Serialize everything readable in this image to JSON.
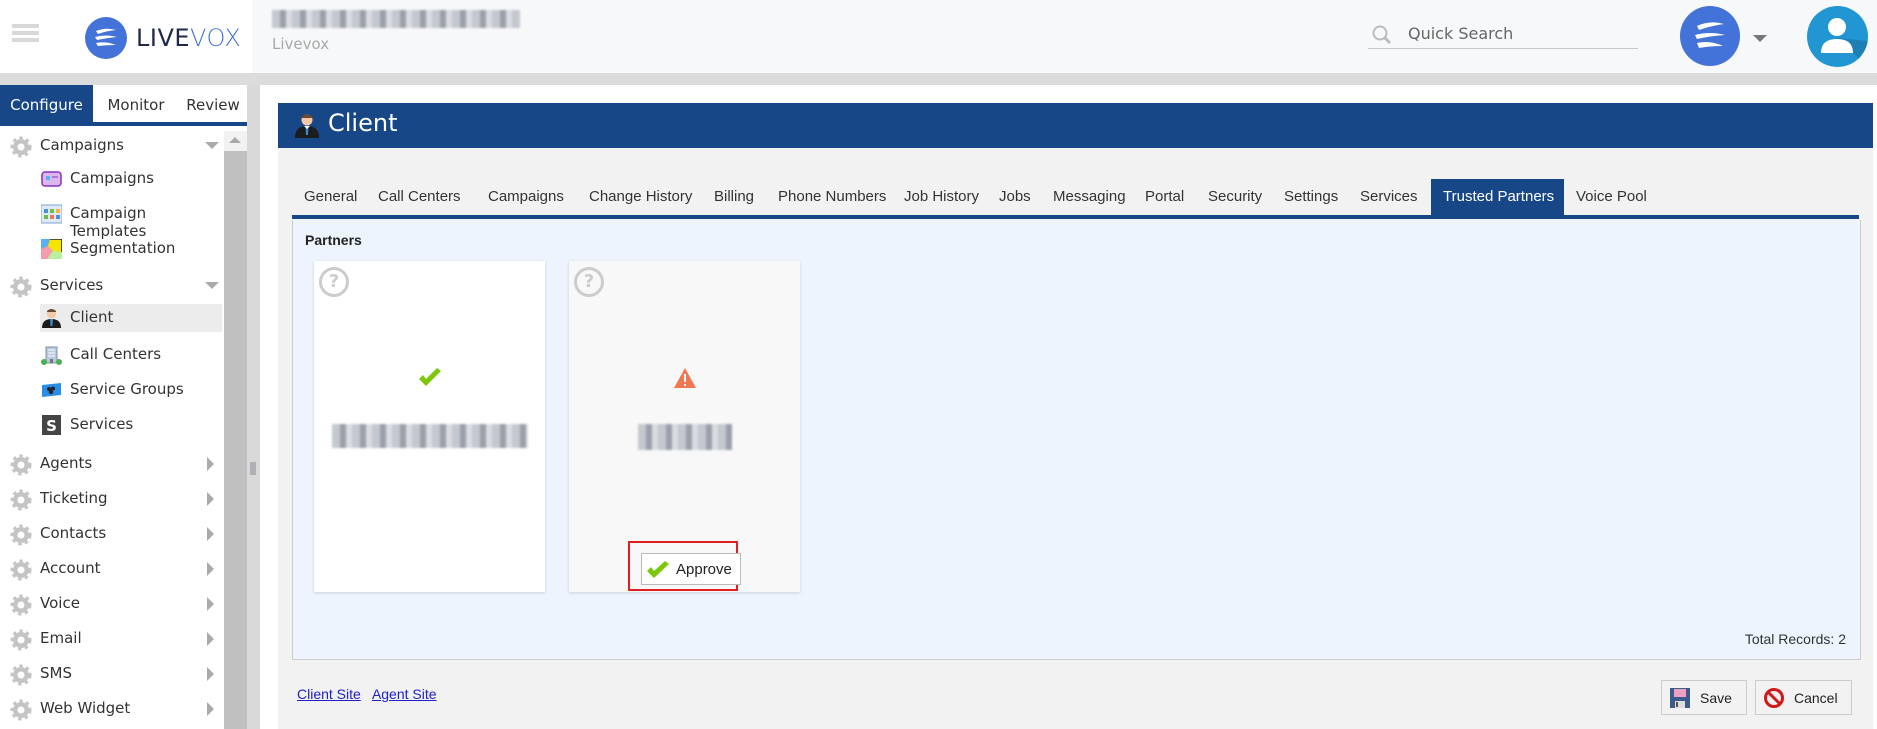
{
  "topbar": {
    "brand_bold": "LIVE",
    "brand_light": "VOX",
    "page_subtitle": "Livevox",
    "search_placeholder": "Quick Search"
  },
  "sidebar": {
    "tabs": [
      {
        "label": "Configure",
        "active": true
      },
      {
        "label": "Monitor",
        "active": false
      },
      {
        "label": "Review",
        "active": false
      }
    ],
    "groups": [
      {
        "label": "Campaigns",
        "expanded": true,
        "children": [
          {
            "label": "Campaigns",
            "icon": "campaign-icon"
          },
          {
            "label": "Campaign Templates",
            "icon": "template-icon"
          },
          {
            "label": "Segmentation",
            "icon": "segmentation-icon"
          }
        ]
      },
      {
        "label": "Services",
        "expanded": true,
        "children": [
          {
            "label": "Client",
            "icon": "client-icon",
            "active": true
          },
          {
            "label": "Call Centers",
            "icon": "building-icon"
          },
          {
            "label": "Service Groups",
            "icon": "group-icon"
          },
          {
            "label": "Services",
            "icon": "services-icon"
          }
        ]
      },
      {
        "label": "Agents"
      },
      {
        "label": "Ticketing"
      },
      {
        "label": "Contacts"
      },
      {
        "label": "Account"
      },
      {
        "label": "Voice"
      },
      {
        "label": "Email"
      },
      {
        "label": "SMS"
      },
      {
        "label": "Web Widget"
      }
    ]
  },
  "main": {
    "title": "Client",
    "tabs": [
      {
        "label": "General"
      },
      {
        "label": "Call Centers"
      },
      {
        "label": "Campaigns"
      },
      {
        "label": "Change History"
      },
      {
        "label": "Billing"
      },
      {
        "label": "Phone Numbers"
      },
      {
        "label": "Job History"
      },
      {
        "label": "Jobs"
      },
      {
        "label": "Messaging"
      },
      {
        "label": "Portal"
      },
      {
        "label": "Security"
      },
      {
        "label": "Settings"
      },
      {
        "label": "Services"
      },
      {
        "label": "Trusted Partners",
        "active": true
      },
      {
        "label": "Voice Pool"
      }
    ],
    "section_title": "Partners",
    "partners": [
      {
        "status": "approved",
        "status_icon": "checkmark-icon",
        "name_redacted": true
      },
      {
        "status": "pending",
        "status_icon": "warning-icon",
        "name_redacted": true,
        "action_label": "Approve"
      }
    ],
    "total_records": "Total Records: 2",
    "links": {
      "client_site": "Client Site",
      "agent_site": "Agent Site"
    },
    "buttons": {
      "save": "Save",
      "cancel": "Cancel"
    }
  },
  "colors": {
    "primary": "#174786",
    "brand_blue": "#4373d8",
    "panel_bg": "#edf4fd",
    "success": "#7dc70a",
    "warning": "#f07850",
    "highlight": "#e02020",
    "link": "#2020c8"
  }
}
